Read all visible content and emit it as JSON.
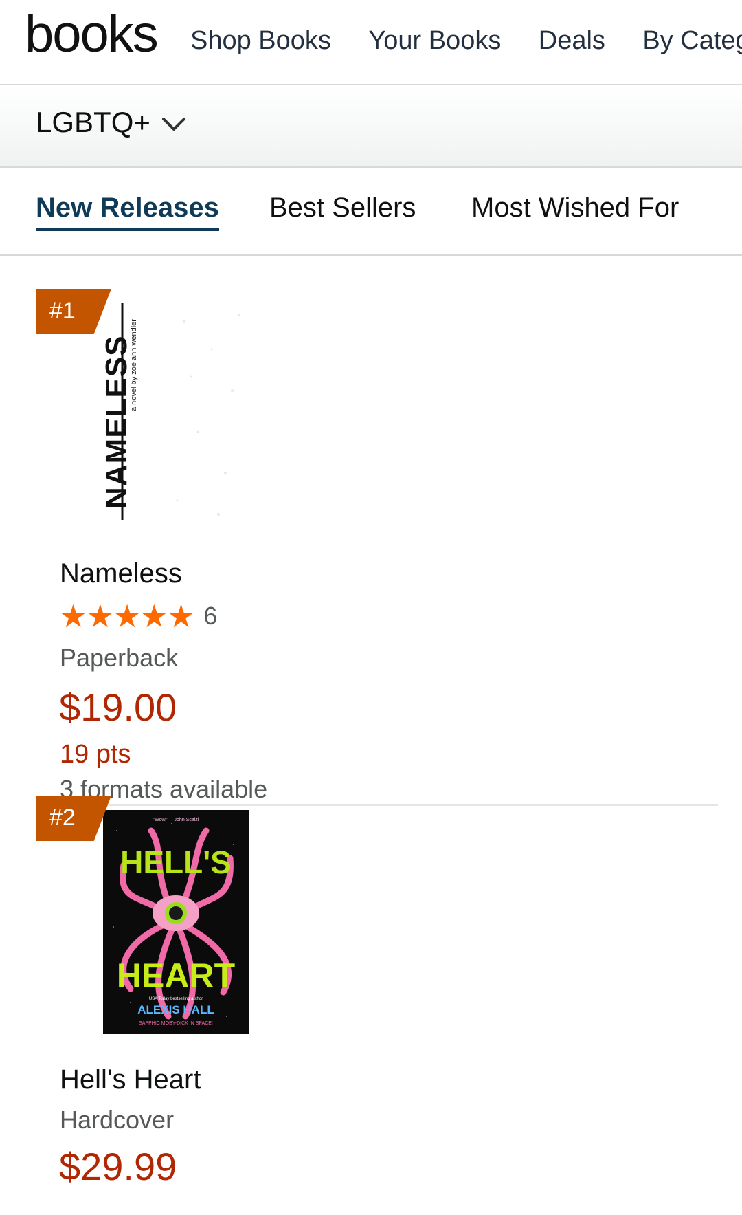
{
  "header": {
    "logo": "books",
    "nav": [
      "Shop Books",
      "Your Books",
      "Deals",
      "By Category"
    ]
  },
  "category": {
    "selected": "LGBTQ+",
    "icon": "chevron-down-icon"
  },
  "tabs": [
    {
      "label": "New Releases",
      "active": true
    },
    {
      "label": "Best Sellers",
      "active": false
    },
    {
      "label": "Most Wished For",
      "active": false
    }
  ],
  "items": [
    {
      "rank": "#1",
      "title": "Nameless",
      "rating": 5,
      "reviews": "6",
      "format": "Paperback",
      "price": "$19.00",
      "points": "19 pts",
      "formats": "3 formats available",
      "cover": {
        "title_text": "NAMELESS",
        "byline": "a novel by zoe ann wendler"
      }
    },
    {
      "rank": "#2",
      "title": "Hell's Heart",
      "format": "Hardcover",
      "price": "$29.99",
      "cover": {
        "quote": "\"Wow.\" —John Scalzi",
        "word1": "HELL'S",
        "word2": "HEART",
        "tagline": "USA Today bestselling author",
        "author": "ALEXIS HALL",
        "subtitle": "SAPPHIC MOBY-DICK IN SPACE!"
      }
    }
  ],
  "colors": {
    "accent": "#c45500",
    "price": "#b12704",
    "star": "#ff6a00",
    "tab_active": "#0f3b59"
  }
}
